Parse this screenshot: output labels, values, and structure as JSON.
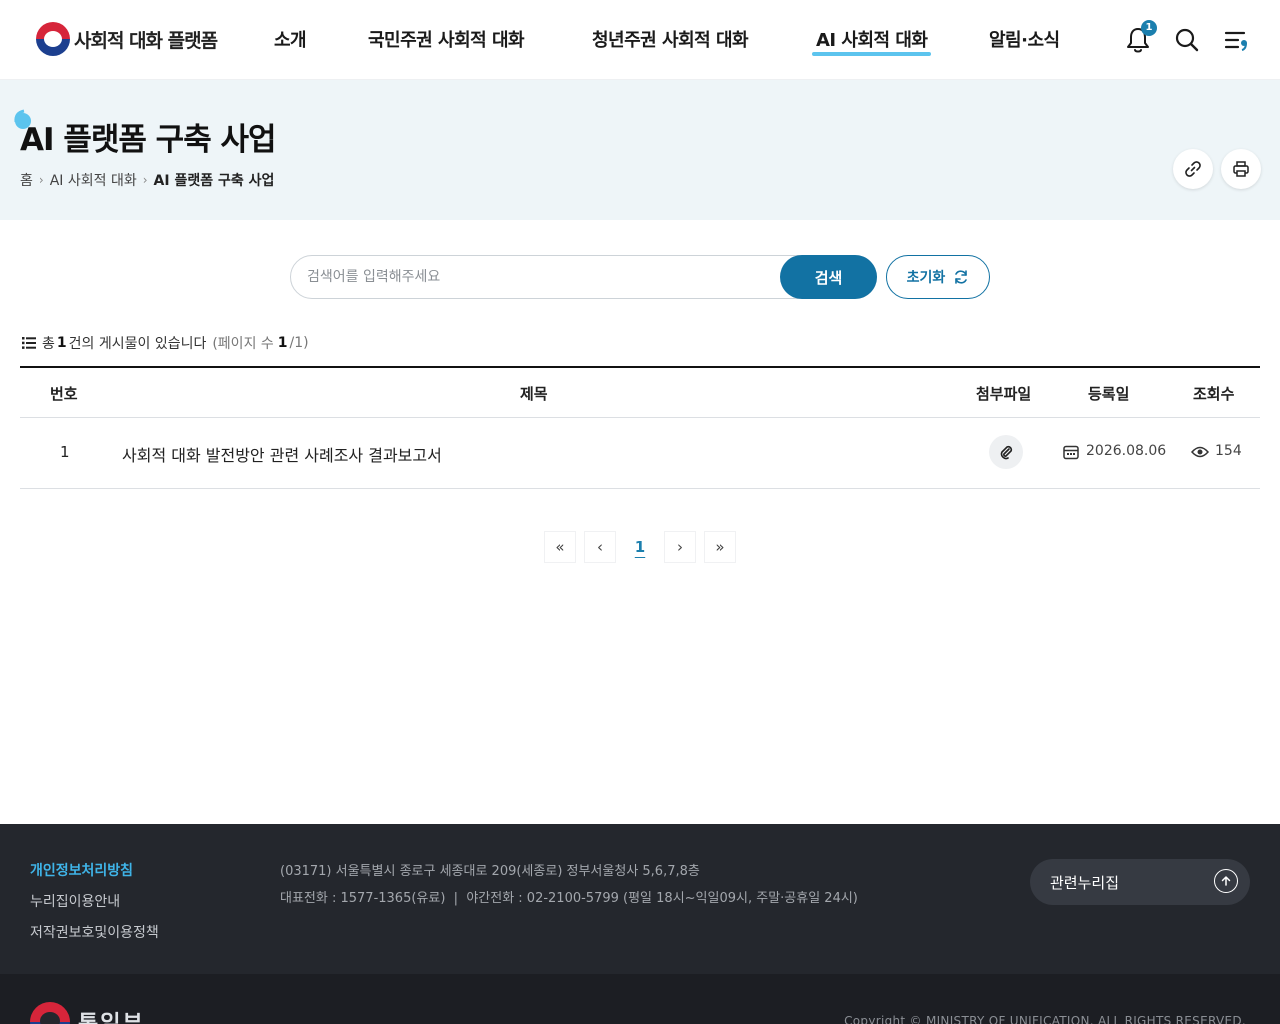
{
  "header": {
    "logo_text": "사회적 대화 플랫폼",
    "nav": [
      {
        "label": "소개"
      },
      {
        "label": "국민주권 사회적 대화"
      },
      {
        "label": "청년주권 사회적 대화"
      },
      {
        "label": "AI 사회적 대화",
        "active": true
      },
      {
        "label": "알림·소식"
      }
    ],
    "notification_count": "1",
    "icons": [
      "bell-icon",
      "search-icon",
      "menu-icon"
    ],
    "accent_color": "#5cc4ee"
  },
  "title_band": {
    "title": "AI 플랫폼 구축 사업",
    "breadcrumb": [
      {
        "label": "홈"
      },
      {
        "label": "AI 사회적 대화"
      },
      {
        "label": "AI 플랫폼 구축 사업"
      }
    ],
    "actions": [
      "link-icon",
      "print-icon"
    ],
    "background": "#eef5f8"
  },
  "search": {
    "placeholder": "검색어를 입력해주세요",
    "value": "",
    "search_label": "검색",
    "reset_label": "초기화",
    "primary_color": "#1272a3"
  },
  "summary": {
    "prefix": "총",
    "total": "1",
    "suffix": "건의 게시물이 있습니다",
    "page_label": "(페이지 수",
    "page_current": "1",
    "page_total": "/1)"
  },
  "table": {
    "columns": [
      "번호",
      "제목",
      "첨부파일",
      "등록일",
      "조회수"
    ],
    "rows": [
      {
        "number": "1",
        "title": "사회적 대화 발전방안 관련 사례조사 결과보고서",
        "has_attachment": true,
        "date": "2026.08.06",
        "views": "154"
      }
    ]
  },
  "pagination": {
    "first": "«",
    "prev": "‹",
    "pages": [
      "1"
    ],
    "current": "1",
    "next": "›",
    "last": "»"
  },
  "footer": {
    "links": [
      "개인정보처리방침",
      "누리집이용안내",
      "저작권보호및이용정책"
    ],
    "address": "(03171) 서울특별시 종로구 세종대로 209(세종로) 정부서울청사 5,6,7,8층",
    "phone": "대표전화 : 1577-1365(유료)  |  야간전화 : 02-2100-5799 (평일 18시~익일09시, 주말·공휴일 24시)",
    "related_sites": "관련누리집",
    "ministry": "통일부",
    "copyright": "Copyright © MINISTRY OF UNIFICATION. ALL RIGHTS RESERVED.",
    "link_highlight_color": "#3fb4e8"
  }
}
